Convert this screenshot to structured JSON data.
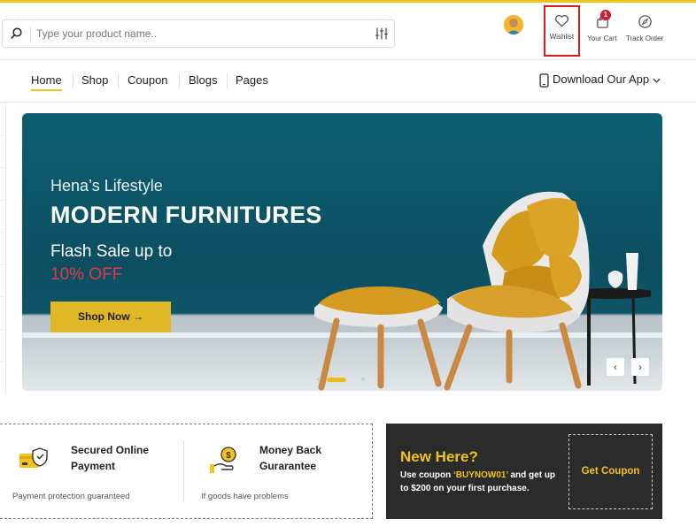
{
  "colors": {
    "accent": "#f2c318",
    "sale_red": "#e5364e",
    "banner_teal": "#0b4f61",
    "highlight_box": "#e11b1b",
    "dark_panel": "#2b2b2b"
  },
  "search": {
    "placeholder": "Type your product name..",
    "value": "",
    "icon": "search-icon",
    "filter_icon": "filter-sliders-icon"
  },
  "header": {
    "avatar_icon": "user-avatar",
    "wishlist": {
      "label": "Wishlist",
      "icon": "heart-icon"
    },
    "cart": {
      "label": "Your Cart",
      "icon": "shopping-bag-icon",
      "count": "1"
    },
    "track": {
      "label": "Track Order",
      "icon": "compass-icon"
    }
  },
  "nav": {
    "items": [
      {
        "label": "Home",
        "active": true
      },
      {
        "label": "Shop"
      },
      {
        "label": "Coupon"
      },
      {
        "label": "Blogs"
      },
      {
        "label": "Pages"
      }
    ],
    "download_app": "Download Our App"
  },
  "banner": {
    "subtitle": "Hena’s Lifestyle",
    "title": "MODERN FURNITURES",
    "flash": "Flash Sale up to",
    "discount": "10% OFF",
    "button": "Shop Now →",
    "prev": "‹",
    "next": "›",
    "slides": 3,
    "active_slide": 2
  },
  "features": [
    {
      "title": "Secured Online Payment",
      "desc": "Payment protection guaranteed",
      "icon": "secure-card-icon"
    },
    {
      "title": "Money Back Gurarantee",
      "desc": "If goods have problems",
      "icon": "money-back-hand-icon"
    }
  ],
  "promo": {
    "title": "New Here?",
    "text_before": "Use coupon ",
    "code": "‘BUYNOW01’",
    "text_after": " and get up to $200 on your first purchase.",
    "button": "Get Coupon"
  }
}
